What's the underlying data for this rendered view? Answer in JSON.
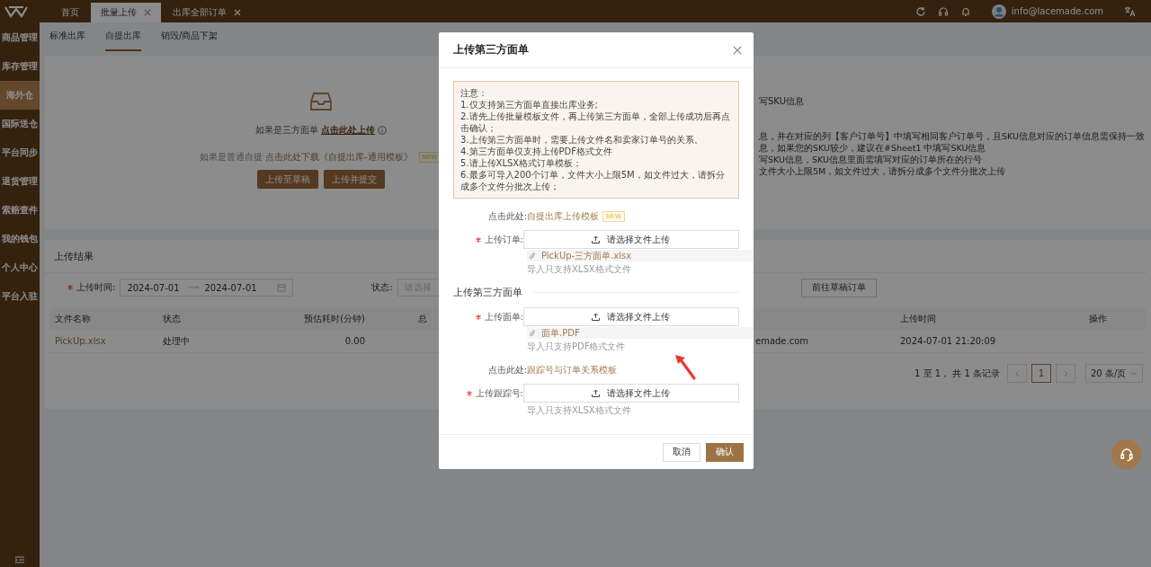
{
  "topbar": {
    "tabs": [
      {
        "label": "首页",
        "closable": false,
        "selected": false
      },
      {
        "label": "批量上传",
        "closable": true,
        "selected": true
      },
      {
        "label": "出库全部订单",
        "closable": true,
        "selected": false
      }
    ],
    "user_email": "info@lacemade.com"
  },
  "sidebar": {
    "items": [
      {
        "label": "商品管理",
        "selected": false
      },
      {
        "label": "库存管理",
        "selected": false
      },
      {
        "label": "海外仓",
        "selected": true
      },
      {
        "label": "国际送仓",
        "selected": false
      },
      {
        "label": "平台同步",
        "selected": false
      },
      {
        "label": "退货管理",
        "selected": false
      },
      {
        "label": "索赔查件",
        "selected": false
      },
      {
        "label": "我的钱包",
        "selected": false
      },
      {
        "label": "个人中心",
        "selected": false
      },
      {
        "label": "平台入驻",
        "selected": false
      }
    ]
  },
  "subtabs": [
    {
      "label": "标准出库",
      "selected": false
    },
    {
      "label": "自提出库",
      "selected": true
    },
    {
      "label": "销毁/商品下架",
      "selected": false
    }
  ],
  "upload_panel": {
    "third_party_prompt": "如果是三方面单",
    "third_party_link": "点击此处上传",
    "normal_prompt": "如果是普通自提",
    "normal_link": "点击此处下载《自提出库-通用模板》",
    "badge": "NEW",
    "buttons": [
      "上传至草稿",
      "上传并提交"
    ]
  },
  "sku_notes": {
    "title": "写SKU信息",
    "lines": [
      "息，并在对应的列【客户订单号】中填写相同客户订单号，且SKU信息对应的订单信息需保持一致",
      "息，如果您的SKU较少，建议在#Sheet1 中填写SKU信息",
      "写SKU信息，SKU信息里面需填写对应的订单所在的行号",
      "文件大小上限5M，如文件过大，请拆分成多个文件分批次上传"
    ]
  },
  "results": {
    "title": "上传结果",
    "time_label": "上传时间:",
    "time_required": true,
    "start_date": "2024-07-01",
    "end_date": "2024-07-01",
    "status_label": "状态:",
    "status_placeholder": "请选择",
    "draft_button": "前往草稿订单",
    "columns": [
      "文件名称",
      "状态",
      "预估耗时(分钟)",
      "总",
      "上传时间",
      "操作"
    ],
    "rows": [
      {
        "file_name": "PickUp.xlsx",
        "status": "处理中",
        "estimated_minutes": "0.00",
        "column_5": "emade.com",
        "upload_time": "2024-07-01 21:20:09"
      }
    ],
    "pagination": {
      "summary": "1 至 1， 共 1 条记录",
      "pages": [
        {
          "label": "1",
          "selected": true
        }
      ],
      "page_size": "20 条/页"
    }
  },
  "modal": {
    "title": "上传第三方面单",
    "notice": [
      "注意：",
      "1.仅支持第三方面单直接出库业务;",
      "2.请先上传批量模板文件，再上传第三方面单，全部上传成功后再点击确认；",
      "3.上传第三方面单时，需要上传文件名和卖家订单号的关系。",
      "4.第三方面单仅支持上传PDF格式文件",
      "5.请上传XLSX格式订单模板；",
      "6.最多可导入200个订单，文件大小上限5M，如文件过大，请拆分成多个文件分批次上传；"
    ],
    "form": [
      {
        "kind": "link",
        "label": "点击此处:",
        "link": "自提出库上传模板",
        "badge": "NEW"
      },
      {
        "kind": "upload",
        "label": "上传订单:",
        "required": true,
        "button": "请选择文件上传",
        "file": "PickUp-三方面单.xlsx",
        "hint": "导入只支持XLSX格式文件"
      },
      {
        "kind": "section",
        "title": "上传第三方面单"
      },
      {
        "kind": "upload",
        "label": "上传面单:",
        "required": true,
        "button": "请选择文件上传",
        "file": "面单.PDF",
        "hint": "导入只支持PDF格式文件"
      },
      {
        "kind": "link",
        "label": "点击此处:",
        "link": "跟踪号与订单关系模板"
      },
      {
        "kind": "upload",
        "label": "上传跟踪号:",
        "required": true,
        "button": "请选择文件上传",
        "hint": "导入只支持XLSX格式文件"
      }
    ],
    "buttons": [
      {
        "label": "取消",
        "kind": "default"
      },
      {
        "label": "确认",
        "kind": "primary"
      }
    ]
  }
}
